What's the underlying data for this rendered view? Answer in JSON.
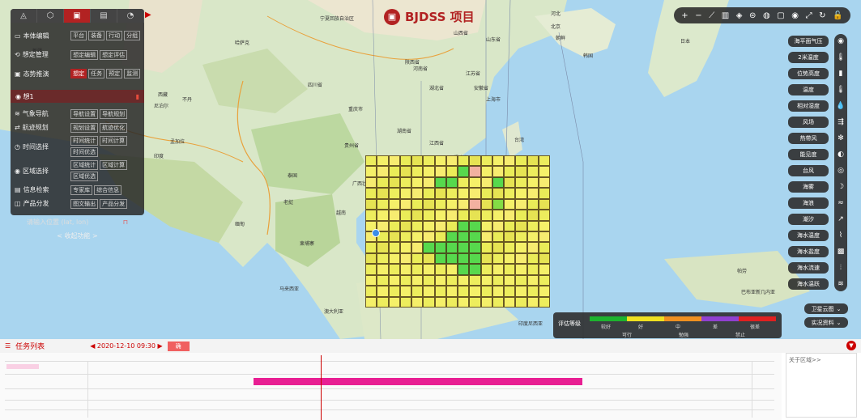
{
  "brand": {
    "icon": "briefcase-icon",
    "title": "BJDSS 项目"
  },
  "panel": {
    "tabs": [
      {
        "icon": "triangle-icon",
        "active": false
      },
      {
        "icon": "cube-icon",
        "active": false
      },
      {
        "icon": "clipboard-icon",
        "active": true
      },
      {
        "icon": "document-icon",
        "active": false
      },
      {
        "icon": "pie-icon",
        "active": false
      }
    ],
    "rows": [
      {
        "icon": "▭",
        "label": "本体编辑",
        "buttons": [
          "平台",
          "装备",
          "行动",
          "分组"
        ],
        "active": -1
      },
      {
        "icon": "⟲",
        "label": "想定管理",
        "buttons": [
          "想定编辑",
          "想定评估"
        ],
        "active": -1
      },
      {
        "icon": "▣",
        "label": "态势推演",
        "buttons": [
          "想定",
          "任务",
          "预定",
          "监测"
        ],
        "active": 0
      }
    ],
    "plan": {
      "name": "想1",
      "delete_icon": "trash-icon"
    },
    "rows2": [
      {
        "icon": "≋",
        "label": "气象导航",
        "buttons": [
          "导航设置",
          "导航规划"
        ]
      },
      {
        "icon": "⇄",
        "label": "航迹规划",
        "buttons": [
          "规划设置",
          "航迹优化"
        ]
      },
      {
        "icon": "◷",
        "label": "时间选择",
        "buttons": [
          "时间统计",
          "时间计算",
          "时间优选"
        ]
      },
      {
        "icon": "◉",
        "label": "区域选择",
        "buttons": [
          "区域统计",
          "区域计算",
          "区域优选"
        ]
      },
      {
        "icon": "▤",
        "label": "信息检索",
        "buttons": [
          "专家库",
          "综合信息"
        ]
      },
      {
        "icon": "◫",
        "label": "产品分发",
        "buttons": [
          "图文输出",
          "产品分发"
        ]
      }
    ],
    "location_label": "请输入位置 (lat, lon)",
    "location_icon": "lock-icon",
    "collapse_label": "< 收起功能 >"
  },
  "toolbar": [
    "+",
    "−",
    "⟋",
    "▥",
    "◈",
    "⊜",
    "◍",
    "▢",
    "◉",
    "⤢",
    "↻",
    "🔓"
  ],
  "layers": [
    "海平面气压",
    "2米温度",
    "位势高度",
    "温度",
    "相对湿度",
    "风场",
    "热带风",
    "能见度",
    "台风",
    "海雾",
    "海浪",
    "潮汐",
    "海水温度",
    "海水盐度",
    "海水流速",
    "海水温跃"
  ],
  "rail_icons": [
    "◉",
    "🌡",
    "▮",
    "🌡",
    "💧",
    "⇶",
    "✻",
    "◐",
    "◎",
    "☽",
    "≈",
    "↗",
    "⌇",
    "▩",
    "⦙",
    "≋"
  ],
  "map_selectors": [
    {
      "label": "卫星云图"
    },
    {
      "label": "实况资料"
    }
  ],
  "legend": {
    "title": "评估等级",
    "colors": [
      "#1db32e",
      "#f0e020",
      "#f09020",
      "#9040d0",
      "#e02020"
    ],
    "levels": [
      "较好",
      "好",
      "中",
      "差",
      "很差"
    ],
    "status": [
      "可行",
      "勉强",
      "禁止"
    ]
  },
  "task": {
    "title": "任务列表",
    "time": "◀ 2020-12-10 09:30 ▶",
    "button": "确",
    "about": "关于区域>>",
    "close_icon": "chevron-down-icon"
  },
  "cities": [
    [
      "宁夏回族自治区",
      395,
      18
    ],
    [
      "山西省",
      560,
      36
    ],
    [
      "河北",
      680,
      12
    ],
    [
      "北京",
      680,
      28
    ],
    [
      "山东省",
      600,
      44
    ],
    [
      "陕西省",
      500,
      72
    ],
    [
      "河南省",
      510,
      80
    ],
    [
      "江苏省",
      575,
      86
    ],
    [
      "湖北省",
      530,
      104
    ],
    [
      "安徽省",
      585,
      104
    ],
    [
      "上海市",
      600,
      118
    ],
    [
      "四川省",
      380,
      100
    ],
    [
      "重庆市",
      430,
      130
    ],
    [
      "贵州省",
      425,
      175
    ],
    [
      "湖南省",
      490,
      157
    ],
    [
      "江西省",
      530,
      172
    ],
    [
      "福建省",
      560,
      190
    ],
    [
      "台湾",
      635,
      168
    ],
    [
      "广西壮族自治区",
      435,
      222
    ],
    [
      "广东省",
      510,
      244
    ],
    [
      "越南",
      415,
      258
    ],
    [
      "海南省",
      490,
      285
    ],
    [
      "泰国",
      355,
      212
    ],
    [
      "老挝",
      350,
      245
    ],
    [
      "缅甸",
      290,
      272
    ],
    [
      "柬埔寨",
      370,
      296
    ],
    [
      "菲律宾",
      590,
      260
    ],
    [
      "马来西亚",
      345,
      352
    ],
    [
      "印度尼西亚",
      640,
      395
    ],
    [
      "日本",
      840,
      46
    ],
    [
      "朝鲜",
      686,
      42
    ],
    [
      "韩国",
      720,
      64
    ],
    [
      "尼泊尔",
      190,
      126
    ],
    [
      "西藏",
      195,
      112
    ],
    [
      "不丹",
      225,
      118
    ],
    [
      "孟加拉",
      210,
      170
    ],
    [
      "印度",
      190,
      188
    ],
    [
      "哈萨克",
      290,
      48
    ],
    [
      "新疆",
      40,
      58
    ],
    [
      "巴布亚新几内亚",
      915,
      356
    ],
    [
      "澳大利亚",
      400,
      380
    ],
    [
      "帕劳",
      910,
      330
    ]
  ],
  "grid_colors": [
    "#eded5d",
    "#f5f069",
    "#f7ec70",
    "#eaec58",
    "#e6e353",
    "#d6e44a",
    "#b9df43",
    "#83dc45",
    "#57d84d",
    "#f2b1a0",
    "#e8dd57"
  ],
  "grid_heat": [
    "0000000000000000",
    "0000000089000000",
    "0000008800080000",
    "0000000000000000",
    "0000000009070000",
    "0000000000000000",
    "0000000088000000",
    "0000000888000000",
    "0000088888000000",
    "0000008888000000",
    "0000000088000000",
    "0000000000000000",
    "0000000000000000",
    "0000000000000000"
  ]
}
